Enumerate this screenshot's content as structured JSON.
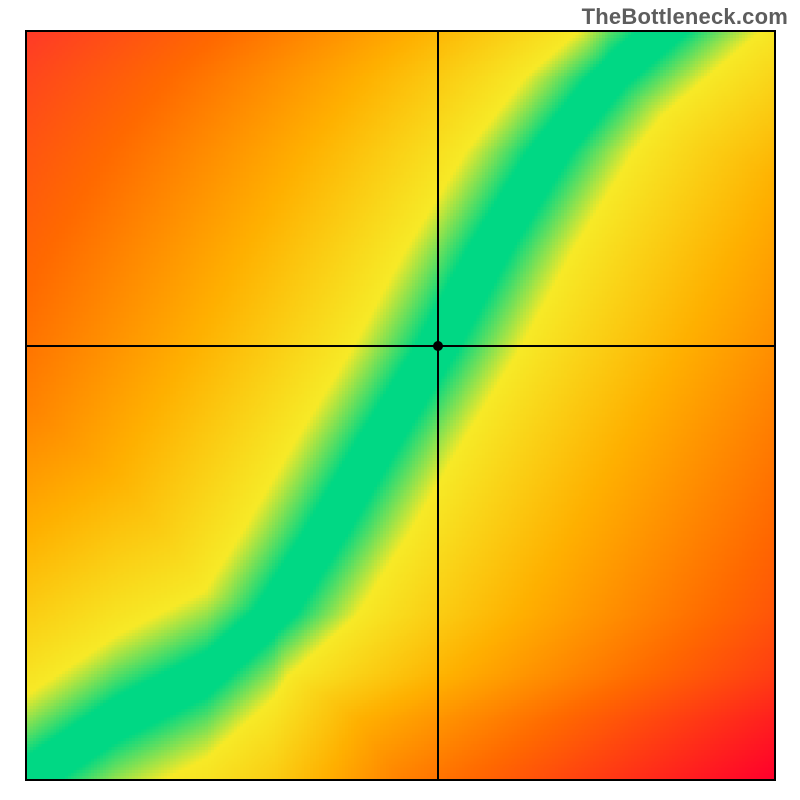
{
  "watermark": "TheBottleneck.com",
  "chart_data": {
    "type": "heatmap",
    "title": "",
    "xlabel": "",
    "ylabel": "",
    "xlim": [
      0,
      100
    ],
    "ylim": [
      0,
      100
    ],
    "grid": false,
    "legend": false,
    "description": "Bottleneck/compatibility heatmap. A narrow diagonal ridge (green) indicates the ideal pairing; color falls off through yellow/orange to red as the pairing becomes imbalanced to either side.",
    "crosshair": {
      "x": 55,
      "y": 58
    },
    "ridge": {
      "comment": "Green-ridge centreline as (x%, y%) control points from bottom-left to top-right; x is horizontal axis, y is vertical axis (both 0–100).",
      "points": [
        [
          0,
          0
        ],
        [
          12,
          8
        ],
        [
          24,
          14
        ],
        [
          33,
          22
        ],
        [
          40,
          33
        ],
        [
          47,
          45
        ],
        [
          55,
          58
        ],
        [
          62,
          71
        ],
        [
          70,
          84
        ],
        [
          78,
          94
        ],
        [
          85,
          100
        ]
      ],
      "half_width_pct": 3.0
    },
    "colors": {
      "ridge_core": "#00d884",
      "near": "#f7ea27",
      "mid": "#ffb000",
      "far": "#ff6a00",
      "corner_tl": "#ff1f3e",
      "corner_br": "#ff002c"
    }
  }
}
